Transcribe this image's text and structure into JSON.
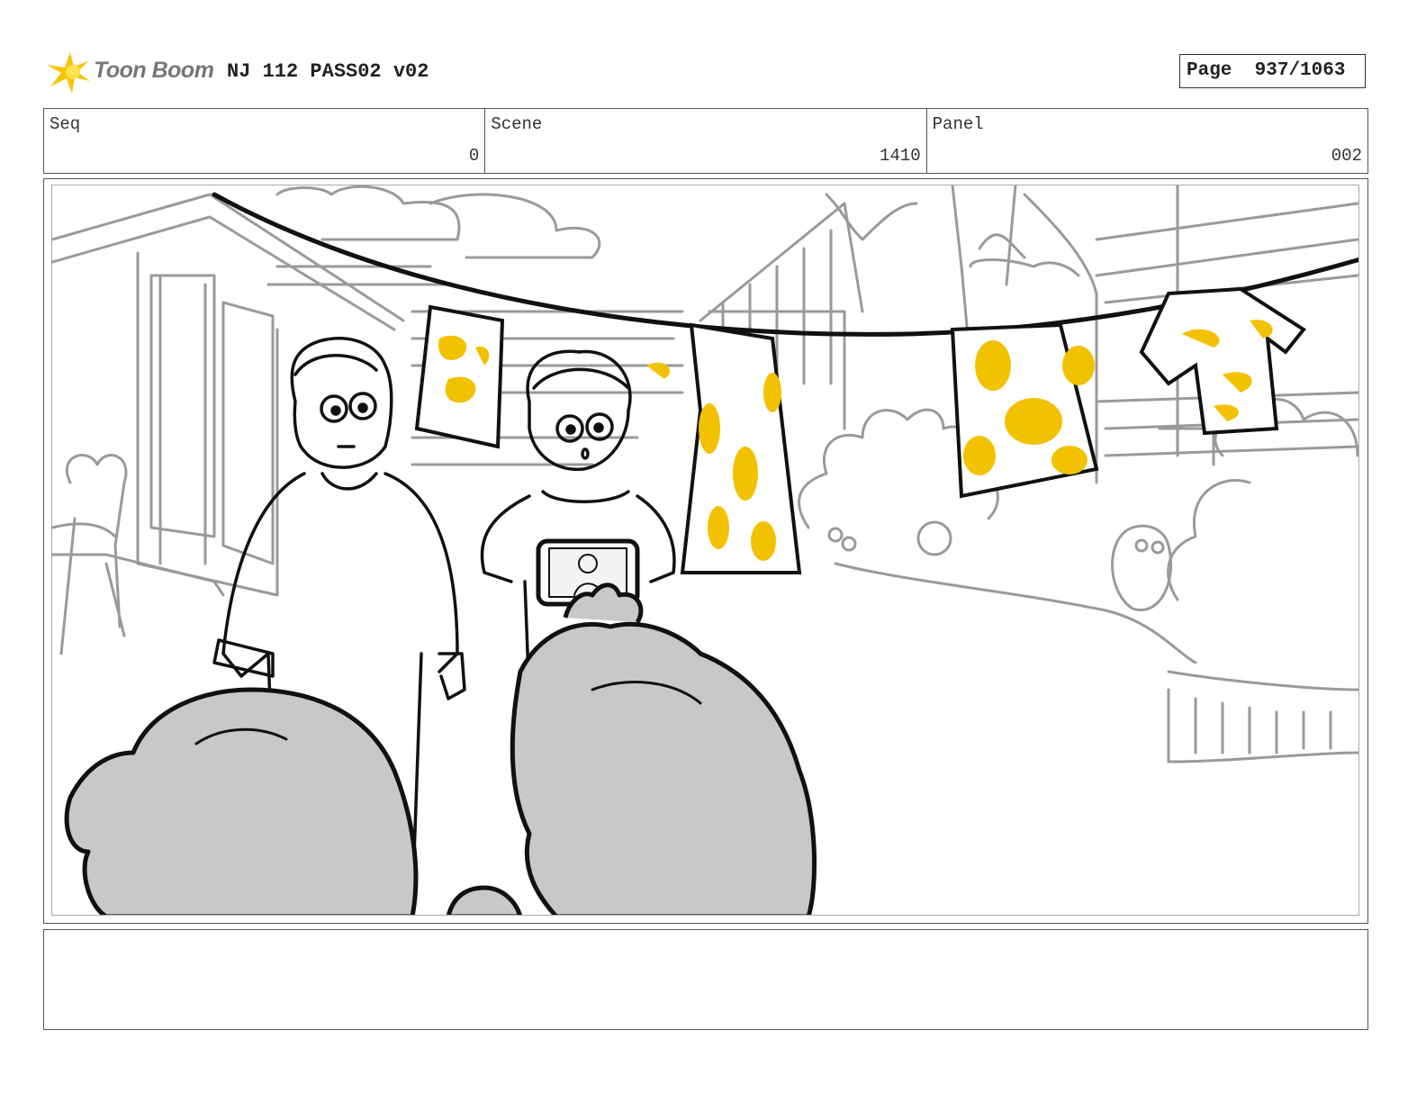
{
  "header": {
    "logo_text": "Toon Boom",
    "project_title": "NJ 112 PASS02 v02",
    "page_label": "Page",
    "page_number": "937/1063"
  },
  "info": {
    "seq_label": "Seq",
    "seq_value": "0",
    "scene_label": "Scene",
    "scene_value": "1410",
    "panel_label": "Panel",
    "panel_value": "002"
  },
  "notes": {
    "text": ""
  },
  "colors": {
    "accent_yellow": "#f2c200",
    "sketch_gray": "#999999",
    "fill_gray": "#c8c8c8",
    "ink_black": "#111111"
  }
}
